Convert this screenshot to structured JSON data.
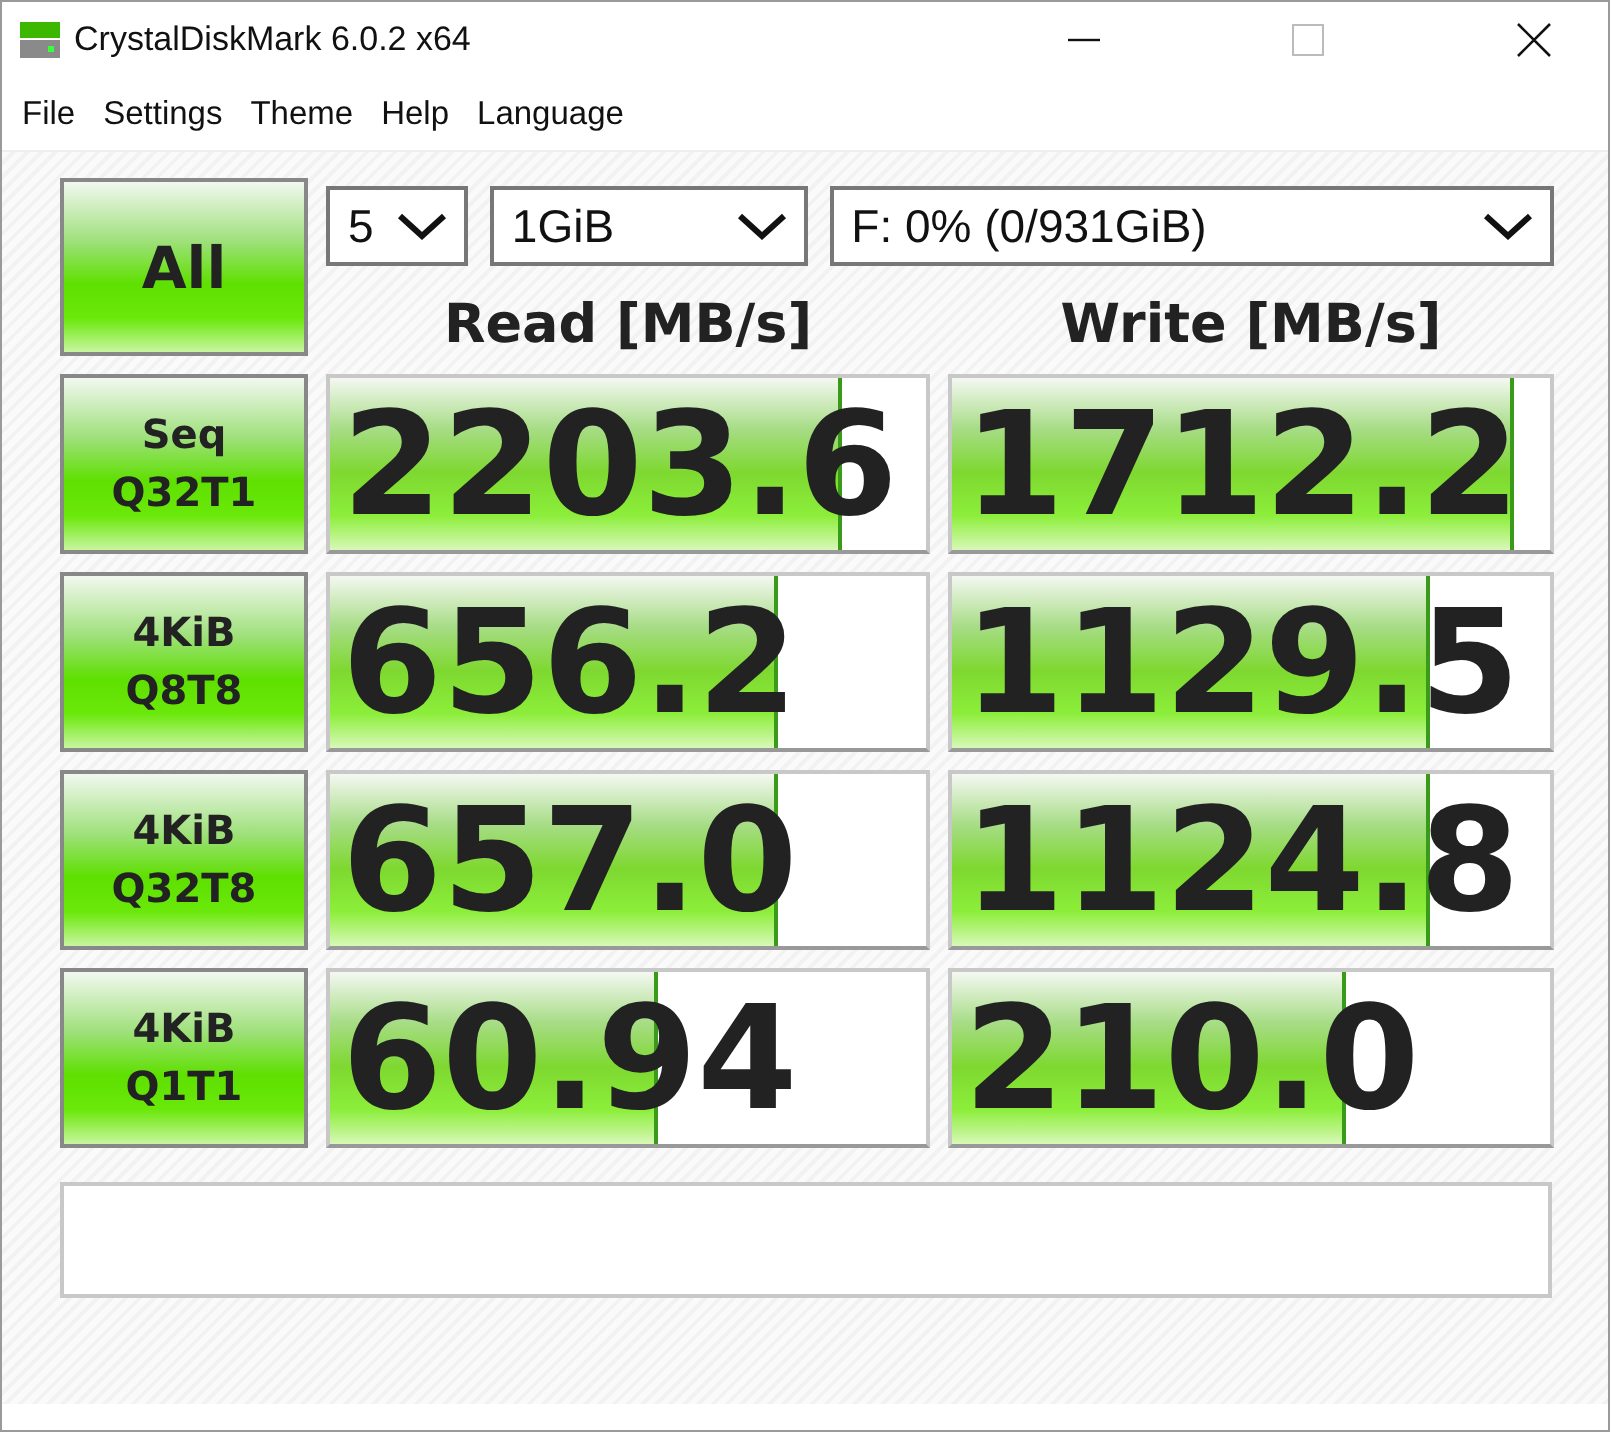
{
  "window": {
    "title": "CrystalDiskMark 6.0.2 x64"
  },
  "menu": [
    "File",
    "Settings",
    "Theme",
    "Help",
    "Language"
  ],
  "all_button": "All",
  "selectors": [
    {
      "value": "5"
    },
    {
      "value": "1GiB"
    },
    {
      "value": "F: 0% (0/931GiB)"
    }
  ],
  "columns": [
    "Read [MB/s]",
    "Write [MB/s]"
  ],
  "tests": [
    {
      "line1": "Seq",
      "line2": "Q32T1",
      "read": {
        "value": "2203.6",
        "level": 0.86
      },
      "write": {
        "value": "1712.2",
        "level": 0.94
      }
    },
    {
      "line1": "4KiB",
      "line2": "Q8T8",
      "read": {
        "value": "656.2",
        "level": 0.75
      },
      "write": {
        "value": "1129.5",
        "level": 0.8
      }
    },
    {
      "line1": "4KiB",
      "line2": "Q32T8",
      "read": {
        "value": "657.0",
        "level": 0.75
      },
      "write": {
        "value": "1124.8",
        "level": 0.8
      }
    },
    {
      "line1": "4KiB",
      "line2": "Q1T1",
      "read": {
        "value": "60.94",
        "level": 0.55
      },
      "write": {
        "value": "210.0",
        "level": 0.66
      }
    }
  ]
}
